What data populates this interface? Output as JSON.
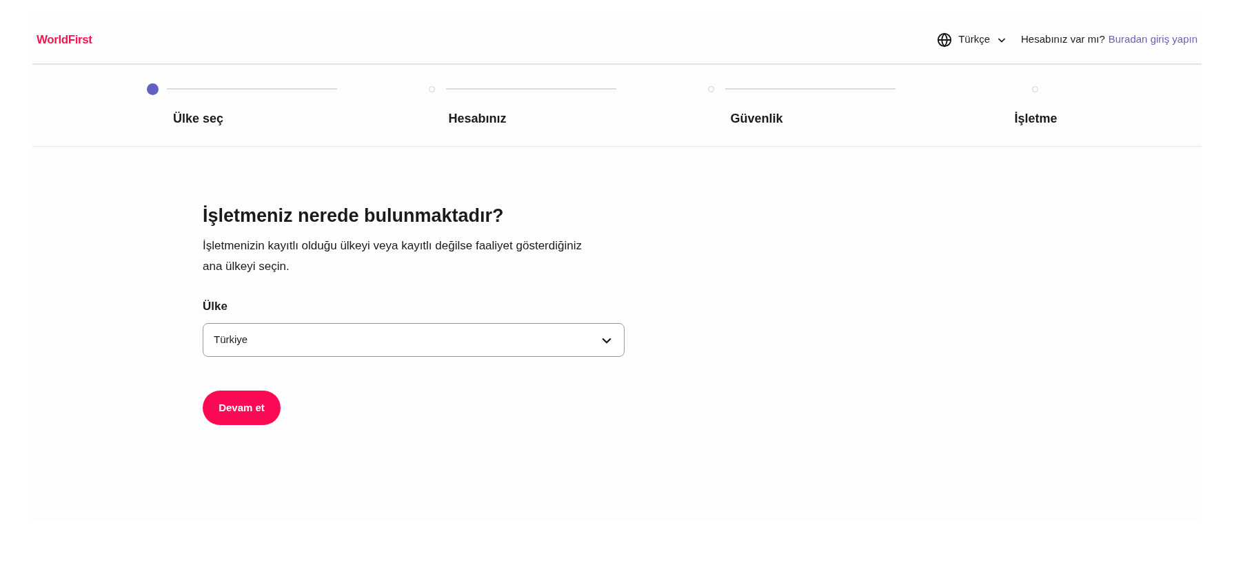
{
  "header": {
    "logo": "WorldFirst",
    "language": "Türkçe",
    "account_prompt": "Hesabınız var mı?",
    "login_link": "Buradan giriş yapın"
  },
  "steps": [
    {
      "label": "Ülke seç",
      "selected": true
    },
    {
      "label": "Hesabınız",
      "selected": false
    },
    {
      "label": "Güvenlik",
      "selected": false
    },
    {
      "label": "İşletme",
      "selected": false
    }
  ],
  "form": {
    "title": "İşletmeniz nerede bulunmaktadır?",
    "description": "İşletmenizin kayıtlı olduğu ülkeyi veya kayıtlı değilse faaliyet gösterdiğiniz ana ülkeyi seçin.",
    "field_label": "Ülke",
    "value": "Türkiye",
    "button": "Devam et"
  }
}
